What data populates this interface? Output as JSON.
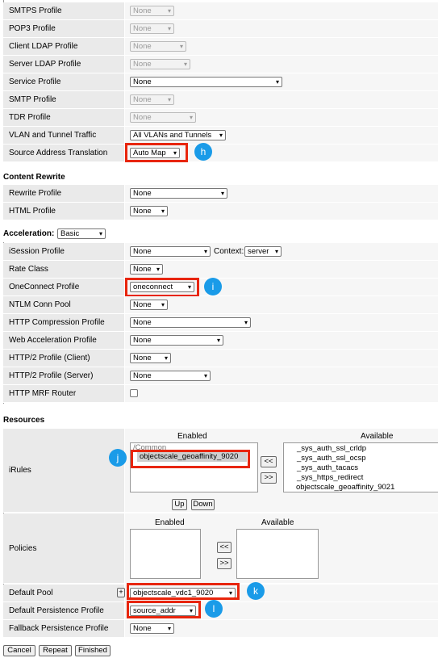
{
  "general_rows": [
    {
      "label": "SMTPS Profile",
      "value": "None",
      "disabled": true
    },
    {
      "label": "POP3 Profile",
      "value": "None",
      "disabled": true
    },
    {
      "label": "Client LDAP Profile",
      "value": "None",
      "disabled": true
    },
    {
      "label": "Server LDAP Profile",
      "value": "None",
      "disabled": true
    },
    {
      "label": "Service Profile",
      "value": "None",
      "disabled": false
    },
    {
      "label": "SMTP Profile",
      "value": "None",
      "disabled": true
    },
    {
      "label": "TDR Profile",
      "value": "None",
      "disabled": true
    },
    {
      "label": "VLAN and Tunnel Traffic",
      "value": "All VLANs and Tunnels",
      "disabled": false
    },
    {
      "label": "Source Address Translation",
      "value": "Auto Map",
      "disabled": false
    }
  ],
  "content_rewrite": {
    "title": "Content Rewrite",
    "rows": [
      {
        "label": "Rewrite Profile",
        "value": "None"
      },
      {
        "label": "HTML Profile",
        "value": "None"
      }
    ]
  },
  "acceleration": {
    "title": "Acceleration:",
    "mode": "Basic",
    "rows": [
      {
        "label": "iSession Profile",
        "value": "None"
      },
      {
        "label": "Rate Class",
        "value": "None"
      },
      {
        "label": "OneConnect Profile",
        "value": "oneconnect"
      },
      {
        "label": "NTLM Conn Pool",
        "value": "None"
      },
      {
        "label": "HTTP Compression Profile",
        "value": "None"
      },
      {
        "label": "Web Acceleration Profile",
        "value": "None"
      },
      {
        "label": "HTTP/2 Profile (Client)",
        "value": "None"
      },
      {
        "label": "HTTP/2 Profile (Server)",
        "value": "None"
      },
      {
        "label": "HTTP MRF Router",
        "value": ""
      }
    ],
    "context_label": "Context:",
    "context_value": "server"
  },
  "resources": {
    "title": "Resources",
    "irules": {
      "label": "iRules",
      "enabled_header": "Enabled",
      "available_header": "Available",
      "enabled_group": "/Common",
      "enabled_items": [
        "objectscale_geoaffinity_9020"
      ],
      "available_items": [
        "_sys_auth_ssl_crldp",
        "_sys_auth_ssl_ocsp",
        "_sys_auth_tacacs",
        "_sys_https_redirect",
        "objectscale_geoaffinity_9021"
      ],
      "add_btn": "<<",
      "remove_btn": ">>",
      "up_btn": "Up",
      "down_btn": "Down"
    },
    "policies": {
      "label": "Policies",
      "enabled_header": "Enabled",
      "available_header": "Available",
      "add_btn": "<<",
      "remove_btn": ">>"
    },
    "default_pool": {
      "label": "Default Pool",
      "plus": "+",
      "value": "objectscale_vdc1_9020"
    },
    "default_persistence": {
      "label": "Default Persistence Profile",
      "value": "source_addr"
    },
    "fallback_persistence": {
      "label": "Fallback Persistence Profile",
      "value": "None"
    }
  },
  "badges": {
    "h": "h",
    "i": "i",
    "j": "j",
    "k": "k",
    "l": "l"
  },
  "footer": {
    "cancel": "Cancel",
    "repeat": "Repeat",
    "finished": "Finished"
  },
  "colors": {
    "highlight": "#e8250c",
    "badge": "#1a9be8"
  }
}
